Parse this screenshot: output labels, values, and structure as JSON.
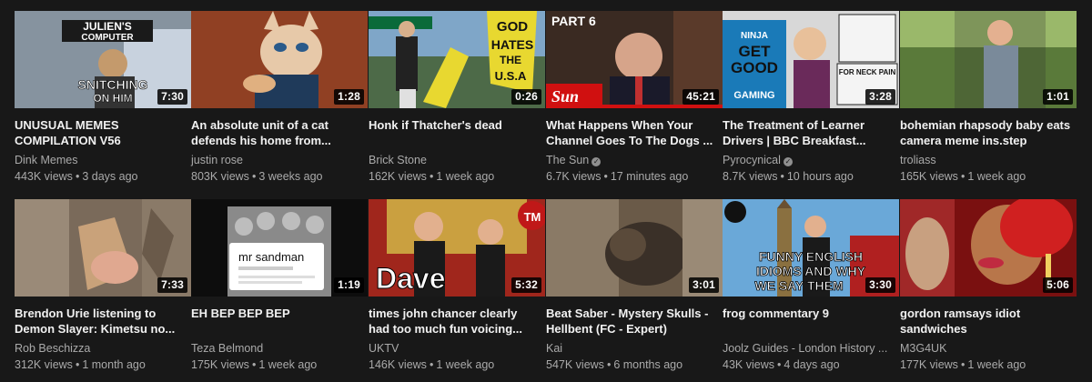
{
  "videos": [
    {
      "title": "UNUSUAL MEMES COMPILATION V56",
      "channel": "Dink Memes",
      "views": "443K views",
      "age": "3 days ago",
      "duration": "7:30",
      "verified": false,
      "thumb_text": {
        "line1": "JULIEN'S",
        "line2": "COMPUTER",
        "line3": "SNITCHING",
        "line4": "ON HIM"
      }
    },
    {
      "title": "An absolute unit of a cat defends his home from...",
      "channel": "justin rose",
      "views": "803K views",
      "age": "3 weeks ago",
      "duration": "1:28",
      "verified": false
    },
    {
      "title": "Honk if Thatcher's dead",
      "channel": "Brick Stone",
      "views": "162K views",
      "age": "1 week ago",
      "duration": "0:26",
      "verified": false,
      "thumb_text": {
        "sign1": "GOD",
        "sign2": "HATES",
        "sign3": "THE",
        "sign4": "U.S.A"
      }
    },
    {
      "title": "What Happens When Your Channel Goes To The Dogs ...",
      "channel": "The Sun",
      "views": "6.7K views",
      "age": "17 minutes ago",
      "duration": "45:21",
      "verified": true,
      "thumb_text": {
        "part": "PART 6",
        "logo": "Sun"
      }
    },
    {
      "title": "The Treatment of Learner Drivers | BBC Breakfast...",
      "channel": "Pyrocynical",
      "views": "8.7K views",
      "age": "10 hours ago",
      "duration": "3:28",
      "verified": true,
      "thumb_text": {
        "book1": "NINJA",
        "book2": "GET",
        "book3": "GOOD",
        "book4": "GAMING",
        "note": "FOR NECK PAIN"
      }
    },
    {
      "title": "bohemian rhapsody baby eats camera meme ins.step",
      "channel": "troliass",
      "views": "165K views",
      "age": "1 week ago",
      "duration": "1:01",
      "verified": false
    },
    {
      "title": "Brendon Urie listening to Demon Slayer: Kimetsu no...",
      "channel": "Rob Beschizza",
      "views": "312K views",
      "age": "1 month ago",
      "duration": "7:33",
      "verified": false
    },
    {
      "title": "EH BEP BEP BEP",
      "channel": "Teza Belmond",
      "views": "175K views",
      "age": "1 week ago",
      "duration": "1:19",
      "verified": false,
      "thumb_text": {
        "handle": "mr sandman"
      }
    },
    {
      "title": "times john chancer clearly had too much fun voicing...",
      "channel": "UKTV",
      "views": "146K views",
      "age": "1 week ago",
      "duration": "5:32",
      "verified": false,
      "thumb_text": {
        "brand": "Dave",
        "badge": "TM"
      }
    },
    {
      "title": "Beat Saber - Mystery Skulls - Hellbent (FC - Expert)",
      "channel": "Kai",
      "views": "547K views",
      "age": "6 months ago",
      "duration": "3:01",
      "verified": false
    },
    {
      "title": "frog commentary 9",
      "channel": "Joolz Guides - London History ...",
      "views": "43K views",
      "age": "4 days ago",
      "duration": "3:30",
      "verified": false,
      "thumb_text": {
        "line1": "FUNNY ENGLISH",
        "line2": "IDIOMS AND WHY",
        "line3": "WE SAY THEM"
      }
    },
    {
      "title": "gordon ramsays idiot sandwiches",
      "channel": "M3G4UK",
      "views": "177K views",
      "age": "1 week ago",
      "duration": "5:06",
      "verified": false
    }
  ],
  "colors": {
    "background": "#181818",
    "title": "#f1f1f1",
    "meta": "#aaaaaa"
  }
}
